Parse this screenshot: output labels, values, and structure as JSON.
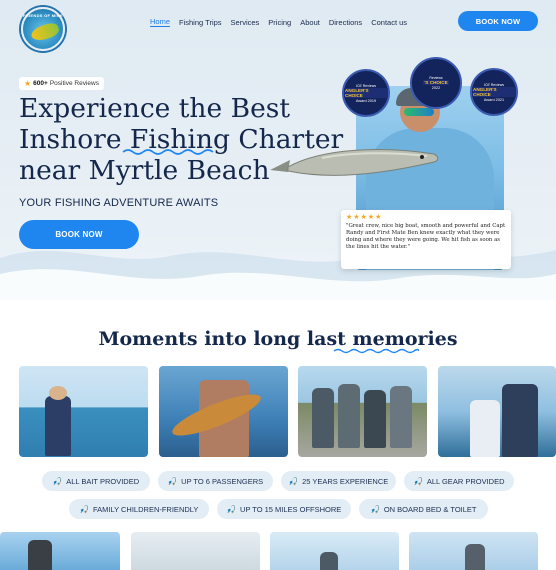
{
  "brand": {
    "logo_text": "FRIENDS OF MINE"
  },
  "nav": {
    "items": [
      "Home",
      "Fishing Trips",
      "Services",
      "Pricing",
      "About",
      "Directions",
      "Contact us"
    ],
    "active": "Home",
    "cta": "BOOK NOW"
  },
  "hero": {
    "reviews_count": "600+",
    "reviews_label": "Positive Reviews",
    "headline": [
      "Experience the Best",
      "Inshore Fishing Charter",
      "near Myrtle Beach"
    ],
    "subhead": "YOUR FISHING ADVENTURE AWAITS",
    "cta": "BOOK NOW",
    "awards": [
      {
        "top": "ICE Reviews",
        "badge": "ANGLER'S CHOICE",
        "year": "Award 2019"
      },
      {
        "top": "Reviews",
        "badge": "'S CHOICE",
        "year": "2022"
      },
      {
        "top": "ICE Reviews",
        "badge": "ANGLER'S CHOICE",
        "year": "Award 2021"
      }
    ],
    "testimonial": {
      "rating": 5,
      "stars": "★★★★★",
      "text": "\"Great crew, nice big boat, smooth and powerful and Capt Randy and First Mate Ben knew exactly what they were doing and where they were going. We hit fish as soon as the lines hit the water.\""
    }
  },
  "moments": {
    "title": "Moments into long last memories",
    "features": [
      "ALL BAIT PROVIDED",
      "UP TO 6 PASSENGERS",
      "25 YEARS EXPERIENCE",
      "ALL GEAR PROVIDED",
      "FAMILY CHILDREN-FRIENDLY",
      "UP TO 15 MILES OFFSHORE",
      "ON BOARD BED & TOILET"
    ]
  },
  "icons": {
    "feature": "fishing-rod-icon",
    "rating": "star-icon"
  },
  "colors": {
    "accent": "#1f86f0",
    "navy": "#15284c",
    "chip_bg": "#e3edf5",
    "star": "#f5a623"
  }
}
